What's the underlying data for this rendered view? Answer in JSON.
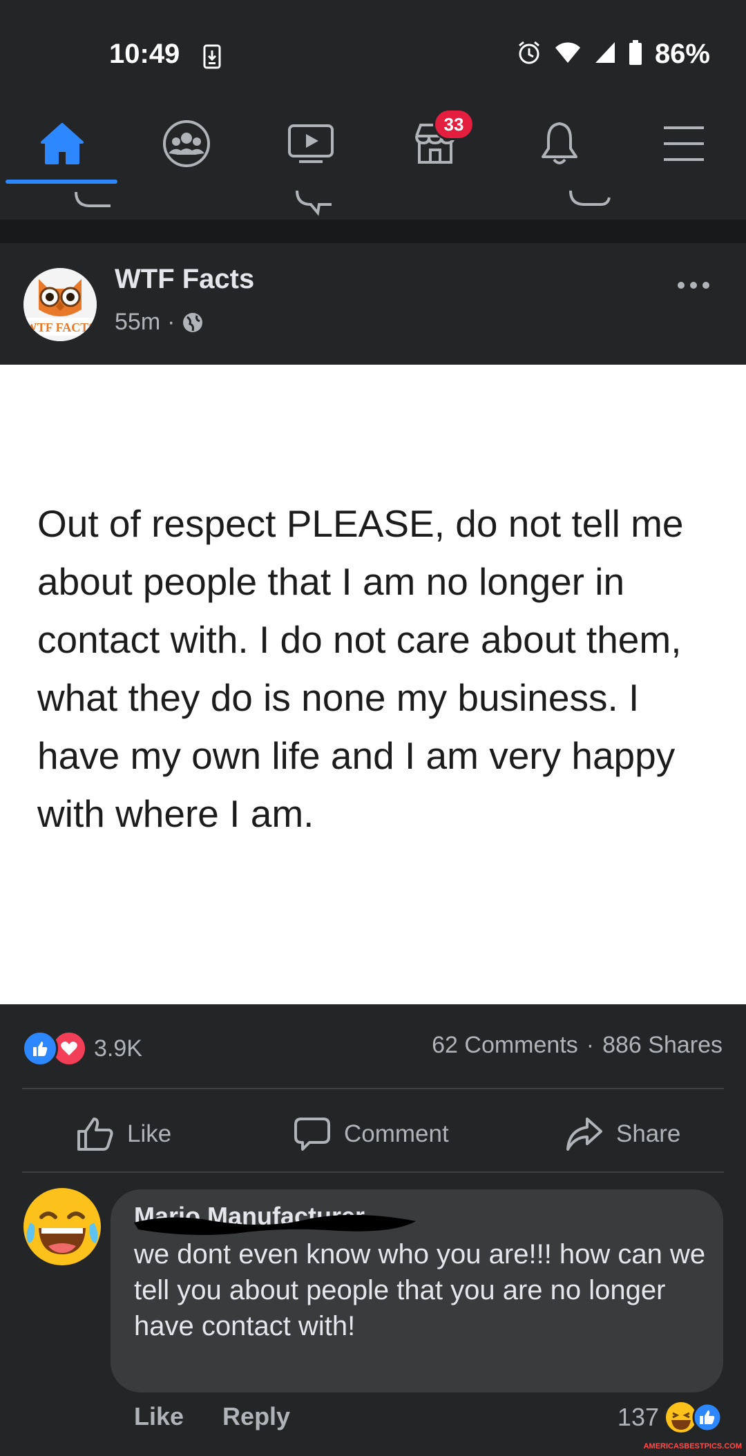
{
  "status_bar": {
    "time": "10:49",
    "battery": "86%"
  },
  "nav": {
    "items": [
      {
        "name": "home",
        "icon": "home-icon",
        "active": true
      },
      {
        "name": "groups",
        "icon": "groups-icon"
      },
      {
        "name": "watch",
        "icon": "video-icon"
      },
      {
        "name": "marketplace",
        "icon": "marketplace-icon",
        "badge": "33"
      },
      {
        "name": "notifications",
        "icon": "bell-icon"
      },
      {
        "name": "menu",
        "icon": "hamburger-icon"
      }
    ],
    "accent": "#2d88ff"
  },
  "post": {
    "page_name": "WTF Facts",
    "time": "55m",
    "separator": "·",
    "avatar_text": "WTF FACTS",
    "text": "Out of respect PLEASE, do not tell me about people that I am no longer in contact with. I do not care about them, what they do is none my business. I have my own life and I am very happy with where I am.",
    "reactions_count": "3.9K",
    "comments": "62 Comments",
    "shares": "886 Shares",
    "stats_sep": "·"
  },
  "actions": {
    "like": "Like",
    "comment": "Comment",
    "share": "Share"
  },
  "comment": {
    "author": "Mario Manufacturer",
    "text": "we dont even know who you are!!! how can we tell you about people that you are no longer have contact with!",
    "like": "Like",
    "reply": "Reply",
    "reaction_count": "137"
  },
  "watermark": "AMERICASBESTPICS.COM"
}
